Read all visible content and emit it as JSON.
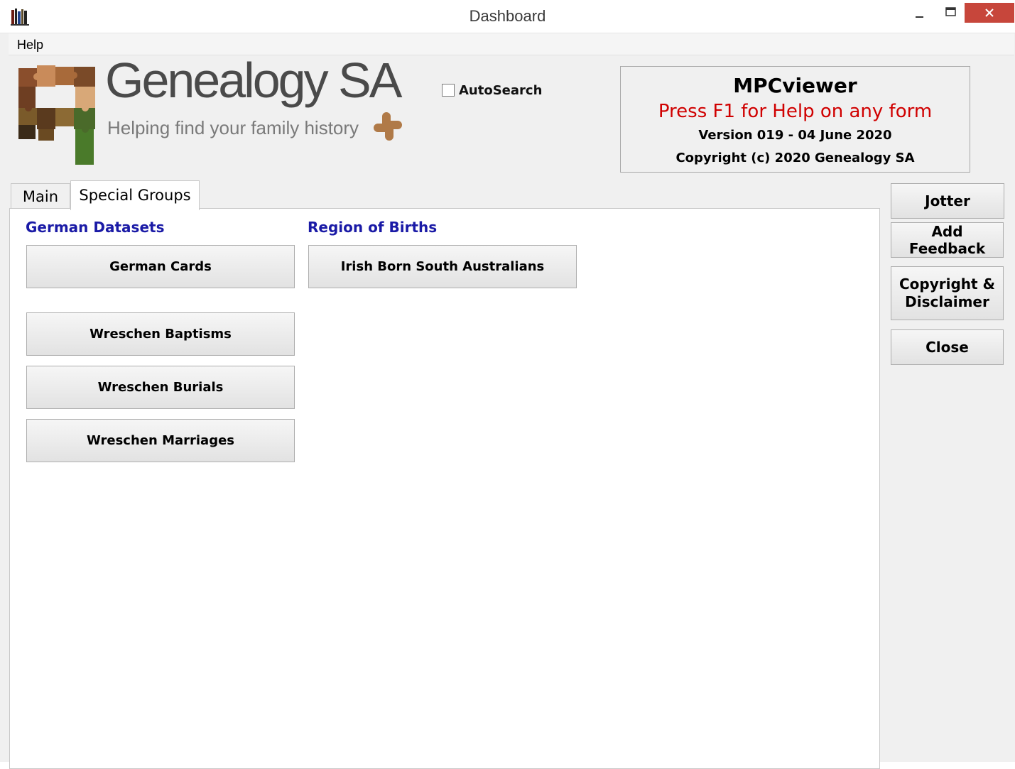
{
  "window": {
    "title": "Dashboard"
  },
  "menu": {
    "help": "Help"
  },
  "logo": {
    "name": "Genealogy SA",
    "tagline": "Helping find your family history"
  },
  "autosearch": {
    "label": "AutoSearch",
    "checked": false
  },
  "info": {
    "title": "MPCviewer",
    "help_text": "Press F1 for Help on any form",
    "version": "Version 019 - 04 June 2020",
    "copyright": "Copyright (c) 2020 Genealogy SA"
  },
  "tabs": [
    {
      "label": "Main",
      "active": false
    },
    {
      "label": "Special Groups",
      "active": true
    }
  ],
  "sections": {
    "german": {
      "heading": "German Datasets",
      "buttons": [
        "German Cards",
        "Wreschen Baptisms",
        "Wreschen Burials",
        "Wreschen Marriages"
      ]
    },
    "region": {
      "heading": "Region of Births",
      "buttons": [
        "Irish Born South Australians"
      ]
    }
  },
  "side_buttons": {
    "jotter": "Jotter",
    "add_feedback": "Add Feedback",
    "copyright_line1": "Copyright &",
    "copyright_line2": "Disclaimer",
    "close": "Close"
  },
  "colors": {
    "heading_blue": "#1a1aa6",
    "help_red": "#d00000",
    "close_button": "#c7463b"
  },
  "icons": {
    "app": "bookshelf-icon",
    "minimize": "minimize-icon",
    "maximize": "maximize-icon",
    "close": "close-icon",
    "logo": "puzzle-logo-icon"
  }
}
